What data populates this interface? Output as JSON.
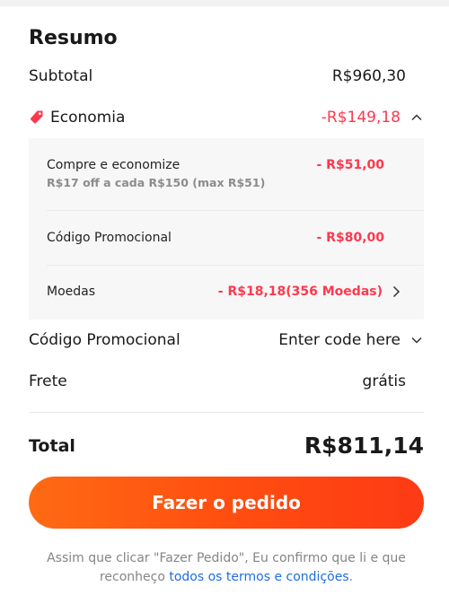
{
  "summary": {
    "title": "Resumo",
    "subtotal": {
      "label": "Subtotal",
      "value": "R$960,30"
    },
    "economia": {
      "label": "Economia",
      "value": "-R$149,18",
      "icon": "tag-icon",
      "expanded": true,
      "items": [
        {
          "name": "Compre e economize",
          "value": "- R$51,00",
          "detail": "R$17 off a cada R$150 (max R$51)"
        },
        {
          "name": "Código Promocional",
          "value": "- R$80,00"
        },
        {
          "name": "Moedas",
          "value": "- R$18,18(356 Moedas)"
        }
      ]
    },
    "promo_code": {
      "label": "Código Promocional",
      "placeholder": "Enter code here"
    },
    "shipping": {
      "label": "Frete",
      "value": "grátis"
    },
    "total": {
      "label": "Total",
      "value": "R$811,14"
    }
  },
  "order_button": {
    "label": "Fazer o pedido"
  },
  "disclaimer": {
    "text": "Assim que clicar \"Fazer Pedido\", Eu confirmo que li e que reconheço ",
    "link": "todos os termos e condições",
    "end": "."
  },
  "colors": {
    "accent_red": "#fd384f",
    "button_gradient_start": "#ff6a13",
    "button_gradient_end": "#fd3a14",
    "link_blue": "#1f6ee0"
  }
}
